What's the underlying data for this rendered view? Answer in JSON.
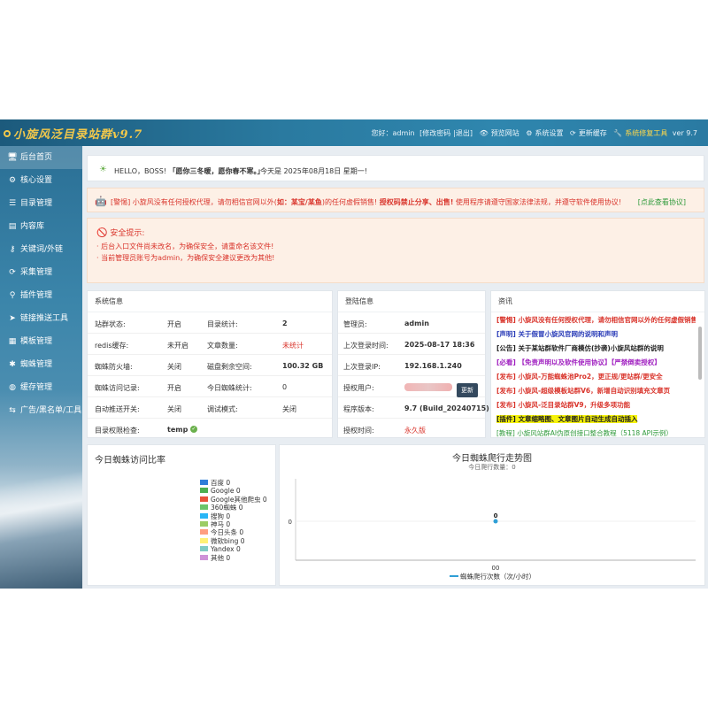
{
  "header": {
    "logo": "小旋风泛目录站群v9.7",
    "greeting": "您好：admin",
    "change_password": "[修改密码",
    "logout": "|退出]",
    "preview": "预览网站",
    "settings": "系统设置",
    "update_cache": "更新缓存",
    "repair_tool": "系统修复工具",
    "version": "ver 9.7"
  },
  "sidebar": {
    "items": [
      {
        "label": "后台首页",
        "icon": "monitor-icon"
      },
      {
        "label": "核心设置",
        "icon": "gear-icon"
      },
      {
        "label": "目录管理",
        "icon": "list-icon"
      },
      {
        "label": "内容库",
        "icon": "book-icon"
      },
      {
        "label": "关键词/外链",
        "icon": "key-icon"
      },
      {
        "label": "采集管理",
        "icon": "refresh-icon"
      },
      {
        "label": "插件管理",
        "icon": "puzzle-icon"
      },
      {
        "label": "链接推送工具",
        "icon": "send-icon"
      },
      {
        "label": "模板管理",
        "icon": "template-icon"
      },
      {
        "label": "蜘蛛管理",
        "icon": "spider-icon"
      },
      {
        "label": "缓存管理",
        "icon": "cache-icon"
      },
      {
        "label": "广告/黑名单/工具",
        "icon": "tools-icon"
      }
    ]
  },
  "hello": {
    "text": "HELLO，BOSS!",
    "quote": "「愿你三冬暖，愿你春不寒。」",
    "date": "今天是 2025年08月18日 星期一!"
  },
  "warning": {
    "prefix": "[警惕] 小旋风没有任何授权代理，请勿相信官网以外(",
    "bold1": "如：某宝/某鱼",
    "mid": ")的任何虚假销售!",
    "bold2": "授权码禁止分享、出售!",
    "suffix": "使用程序请遵守国家法律法规，并遵守软件使用协议!",
    "link": "[点此查看协议]"
  },
  "security": {
    "title": "安全提示:",
    "line1": "· 后台入口文件尚未改名，为确保安全，请重命名该文件!",
    "line2": "· 当前管理员账号为admin，为确保安全建议更改为其他!"
  },
  "system": {
    "title": "系统信息",
    "rows": [
      {
        "k1": "站群状态:",
        "v1": "开启",
        "k2": "目录统计:",
        "v2": "2"
      },
      {
        "k1": "redis缓存:",
        "v1": "未开启",
        "k2": "文章数量:",
        "v2": "未统计"
      },
      {
        "k1": "蜘蛛防火墙:",
        "v1": "关闭",
        "k2": "磁盘剩余空间:",
        "v2": "100.32 GB"
      },
      {
        "k1": "蜘蛛访问记录:",
        "v1": "开启",
        "k2": "今日蜘蛛统计:",
        "v2": "0"
      },
      {
        "k1": "自动推送开关:",
        "v1": "关闭",
        "k2": "调试模式:",
        "v2": "关闭"
      },
      {
        "k1": "目录权限检查:",
        "v1": "temp",
        "k2": "",
        "v2": ""
      }
    ]
  },
  "login": {
    "title": "登陆信息",
    "admin_label": "管理员:",
    "admin_value": "admin",
    "last_time_label": "上次登录时间:",
    "last_time_value": "2025-08-17 18:36",
    "last_ip_label": "上次登录IP:",
    "last_ip_value": "192.168.1.240",
    "auth_user_label": "授权用户:",
    "update_button": "更新",
    "version_label": "程序版本:",
    "version_value": "9.7 (Build_20240715)",
    "auth_time_label": "授权时间:",
    "auth_time_value": "永久版"
  },
  "news": {
    "title": "资讯",
    "items": [
      {
        "text": "[警惕] 小旋风没有任何授权代理，请勿相信官网以外的任何虚假销售",
        "color": "#d9342b",
        "bg": "",
        "bold": true
      },
      {
        "text": "[声明] 关于假冒小旋风官网的说明和声明",
        "color": "#2b3db8",
        "bg": "",
        "bold": true
      },
      {
        "text": "[公告] 关于某站群软件厂商模仿(抄袭)小旋风站群的说明",
        "color": "#222222",
        "bg": "",
        "bold": true
      },
      {
        "text": "[必看] 【免责声明以及软件使用协议】【严禁倒卖授权】",
        "color": "#a020c0",
        "bg": "",
        "bold": true
      },
      {
        "text": "[发布] 小旋风-万能蜘蛛池Pro2，更正规/更站群/更安全",
        "color": "#d9342b",
        "bg": "",
        "bold": true
      },
      {
        "text": "[发布] 小旋风-超级模板站群V6，新增自动识别填充文章页",
        "color": "#d9342b",
        "bg": "",
        "bold": true
      },
      {
        "text": "[发布] 小旋风-泛目录站群V9，升级多项功能",
        "color": "#d9342b",
        "bg": "",
        "bold": true
      },
      {
        "text": "[插件] 文章缩略图、文章图片自动生成自动插入",
        "color": "#222222",
        "bg": "#f5f20a",
        "bold": true
      },
      {
        "text": "[教程] 小旋风站群AI伪原创接口整合教程（5118 API示例）",
        "color": "#2f9a3b",
        "bg": "",
        "bold": false
      }
    ]
  },
  "pie_chart": {
    "title": "今日蜘蛛访问比率",
    "legend": [
      {
        "label": "百度 0",
        "color": "#2f7ed8"
      },
      {
        "label": "Google 0",
        "color": "#4caf50"
      },
      {
        "label": "Google其他爬虫 0",
        "color": "#e8533b"
      },
      {
        "label": "360蜘蛛 0",
        "color": "#6bc46b"
      },
      {
        "label": "搜狗 0",
        "color": "#29b6f6"
      },
      {
        "label": "神马 0",
        "color": "#9ccc65"
      },
      {
        "label": "今日头条 0",
        "color": "#ff9e80"
      },
      {
        "label": "微软bing 0",
        "color": "#fff176"
      },
      {
        "label": "Yandex 0",
        "color": "#80cbc4"
      },
      {
        "label": "其他 0",
        "color": "#ce93d8"
      }
    ]
  },
  "chart_data": {
    "type": "line",
    "title": "今日蜘蛛爬行走势图",
    "subtitle": "今日爬行数量：0",
    "x": [
      "00"
    ],
    "series": [
      {
        "name": "蜘蛛爬行次数（次/小时）",
        "values": [
          0
        ],
        "color": "#2f9fd6"
      }
    ],
    "y_ticks": [
      "0"
    ],
    "data_labels": [
      "0"
    ]
  }
}
